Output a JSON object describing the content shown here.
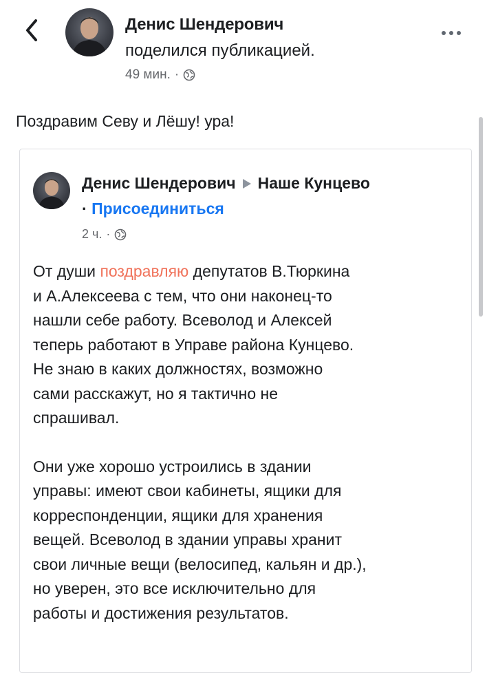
{
  "header": {
    "back_icon": "chevron-left-icon",
    "author_name": "Денис Шендерович",
    "action_text": "поделился публикацией.",
    "time": "49 мин.",
    "separator": "·",
    "privacy_icon": "globe-icon",
    "more_icon": "more-horizontal-icon"
  },
  "post": {
    "text": "Поздравим Севу и Лёшу! ура!"
  },
  "shared": {
    "author_name": "Денис Шендерович",
    "arrow_icon": "triangle-right-icon",
    "group_name": "Наше Кунцево",
    "separator": "·",
    "join_label": "Присоединиться",
    "time": "2 ч.",
    "privacy_icon": "globe-icon",
    "body": {
      "lines_p1": [
        {
          "pre": "От души ",
          "highlight": "поздравляю",
          "post": " депутатов В.Тюркина"
        },
        {
          "text": "и А.Алексеева с тем, что они наконец-то"
        },
        {
          "text": "нашли себе работу. Всеволод и Алексей"
        },
        {
          "text": "теперь работают в Управе района Кунцево."
        },
        {
          "text": "Не знаю в каких должностях, возможно"
        },
        {
          "text": "сами расскажут, но я тактично не"
        },
        {
          "text": "спрашивал."
        }
      ],
      "lines_p2": [
        "Они уже хорошо устроились в здании",
        "управы: имеют свои кабинеты, ящики для",
        "корреспонденции, ящики для хранения",
        "вещей. Всеволод в здании управы хранит",
        "свои личные вещи (велосипед, кальян и др.),",
        "но уверен, это все исключительно для",
        "работы и достижения результатов."
      ]
    }
  },
  "colors": {
    "link": "#1877f2",
    "highlight": "#f0725a",
    "meta": "#65676b"
  }
}
